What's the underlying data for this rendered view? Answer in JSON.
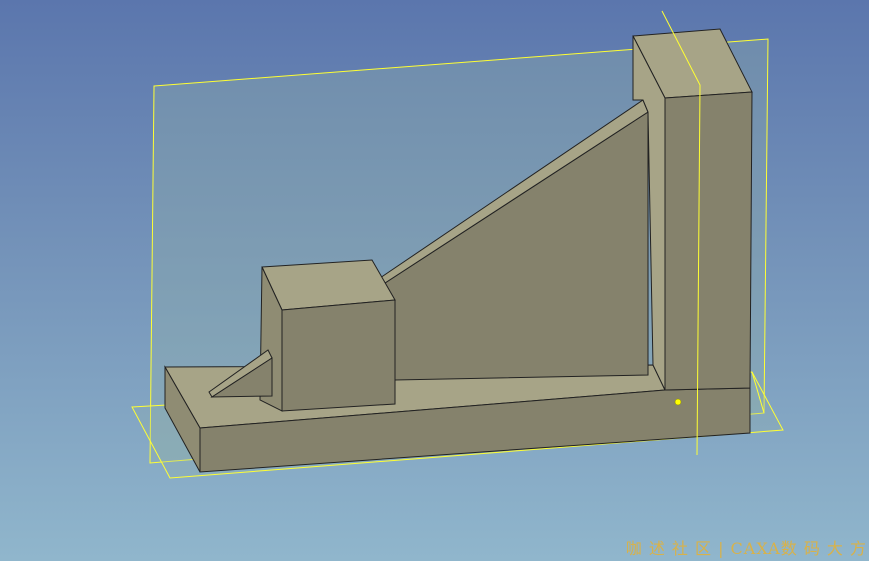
{
  "viewport": {
    "background_top": "#5b76ad",
    "background_bottom": "#90b6cc"
  },
  "model": {
    "face_light": "#a7a487",
    "face_mid": "#8f8c73",
    "face_dark": "#85826c",
    "edge_color": "#222222"
  },
  "planes": {
    "outline_color": "#ffff33",
    "fill_color": "#8fb0a8"
  },
  "selection_point": {
    "icon": "yellow-dot-marker",
    "color": "#ffff00"
  },
  "watermark": {
    "text": "咖 述 社 区 | CAXA数 码 大 方",
    "color": "#d8b24a"
  }
}
